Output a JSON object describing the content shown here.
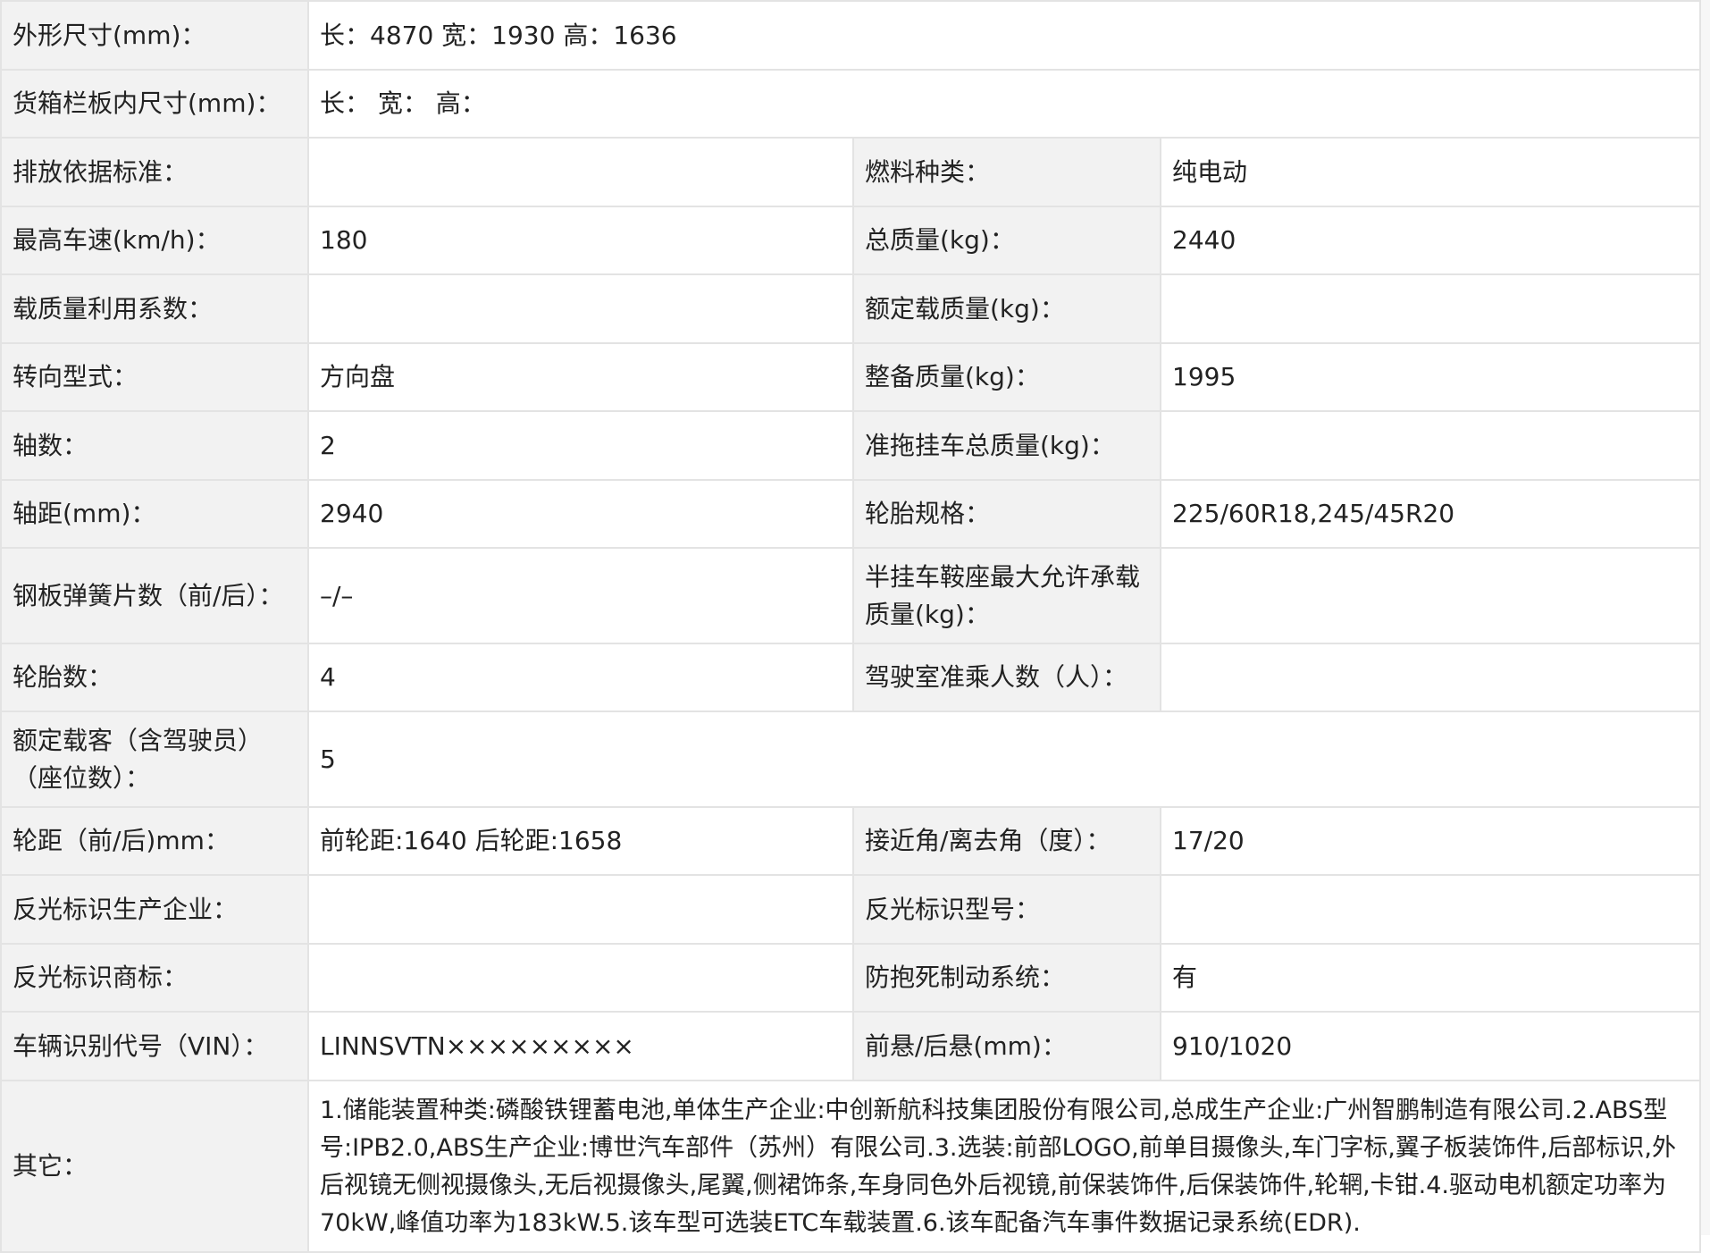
{
  "rows": [
    {
      "label": "外形尺寸(mm)：",
      "value": "长：4870 宽：1930 高：1636"
    },
    {
      "label": "货箱栏板内尺寸(mm)：",
      "value": "长：  宽：  高："
    },
    {
      "label1": "排放依据标准：",
      "value1": "",
      "label2": "燃料种类：",
      "value2": "纯电动"
    },
    {
      "label1": "最高车速(km/h)：",
      "value1": "180",
      "label2": "总质量(kg)：",
      "value2": "2440"
    },
    {
      "label1": "载质量利用系数：",
      "value1": "",
      "label2": "额定载质量(kg)：",
      "value2": ""
    },
    {
      "label1": "转向型式：",
      "value1": "方向盘",
      "label2": "整备质量(kg)：",
      "value2": "1995"
    },
    {
      "label1": "轴数：",
      "value1": "2",
      "label2": "准拖挂车总质量(kg)：",
      "value2": ""
    },
    {
      "label1": "轴距(mm)：",
      "value1": "2940",
      "label2": "轮胎规格：",
      "value2": "225/60R18,245/45R20"
    },
    {
      "label1": "钢板弹簧片数（前/后）：",
      "value1": "–/–",
      "label2": "半挂车鞍座最大允许承载质量(kg)：",
      "value2": ""
    },
    {
      "label1": "轮胎数：",
      "value1": "4",
      "label2": "驾驶室准乘人数（人）：",
      "value2": ""
    },
    {
      "label": "额定载客（含驾驶员）（座位数）：",
      "value": "5"
    },
    {
      "label1": "轮距（前/后)mm：",
      "value1": "前轮距:1640 后轮距:1658",
      "label2": "接近角/离去角（度）：",
      "value2": "17/20"
    },
    {
      "label1": "反光标识生产企业：",
      "value1": "",
      "label2": "反光标识型号：",
      "value2": ""
    },
    {
      "label1": "反光标识商标：",
      "value1": "",
      "label2": "防抱死制动系统：",
      "value2": "有"
    },
    {
      "label1": "车辆识别代号（VIN）：",
      "value1": "LINNSVTN×××××××××",
      "label2": "前悬/后悬(mm)：",
      "value2": "910/1020"
    },
    {
      "label": "其它：",
      "value": "1.储能装置种类:磷酸铁锂蓄电池,单体生产企业:中创新航科技集团股份有限公司,总成生产企业:广州智鹏制造有限公司.2.ABS型号:IPB2.0,ABS生产企业:博世汽车部件（苏州）有限公司.3.选装:前部LOGO,前单目摄像头,车门字标,翼子板装饰件,后部标识,外后视镜无侧视摄像头,无后视摄像头,尾翼,侧裙饰条,车身同色外后视镜,前保装饰件,后保装饰件,轮辋,卡钳.4.驱动电机额定功率为70kW,峰值功率为183kW.5.该车型可选装ETC车载装置.6.该车配备汽车事件数据记录系统(EDR)."
    }
  ]
}
